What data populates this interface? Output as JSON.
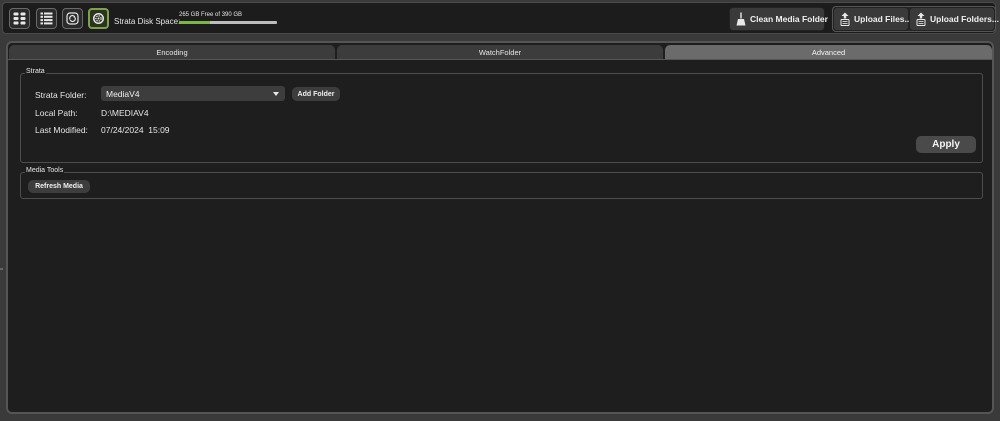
{
  "toolbar": {
    "view_buttons": [
      {
        "icon": "grid-view-icon"
      },
      {
        "icon": "list-view-icon"
      },
      {
        "icon": "refresh-cycle-icon"
      },
      {
        "icon": "settings-gear-icon",
        "active": true
      }
    ],
    "disk_space_label": "Strata Disk Space:",
    "disk_space_text": "265 GB Free of 390 GB",
    "disk_free_fraction": 0.32,
    "clean_media_label": "Clean Media Folder",
    "upload_files_label": "Upload Files...",
    "upload_folders_label": "Upload Folders..."
  },
  "tabs": [
    {
      "label": "Encoding",
      "active": false
    },
    {
      "label": "WatchFolder",
      "active": false
    },
    {
      "label": "Advanced",
      "active": true
    }
  ],
  "strata_group": {
    "title": "Strata",
    "folder_label": "Strata Folder:",
    "folder_value": "MediaV4",
    "add_folder_label": "Add Folder",
    "local_path_label": "Local Path:",
    "local_path_value": "D:\\MEDIAV4",
    "last_modified_label": "Last Modified:",
    "last_modified_value": "07/24/2024  15:09",
    "apply_label": "Apply"
  },
  "media_tools_group": {
    "title": "Media Tools",
    "refresh_label": "Refresh Media"
  },
  "colors": {
    "accent_green": "#7ab648",
    "active_tab": "#6b6b6b",
    "panel_bg": "#1e1e1e"
  }
}
